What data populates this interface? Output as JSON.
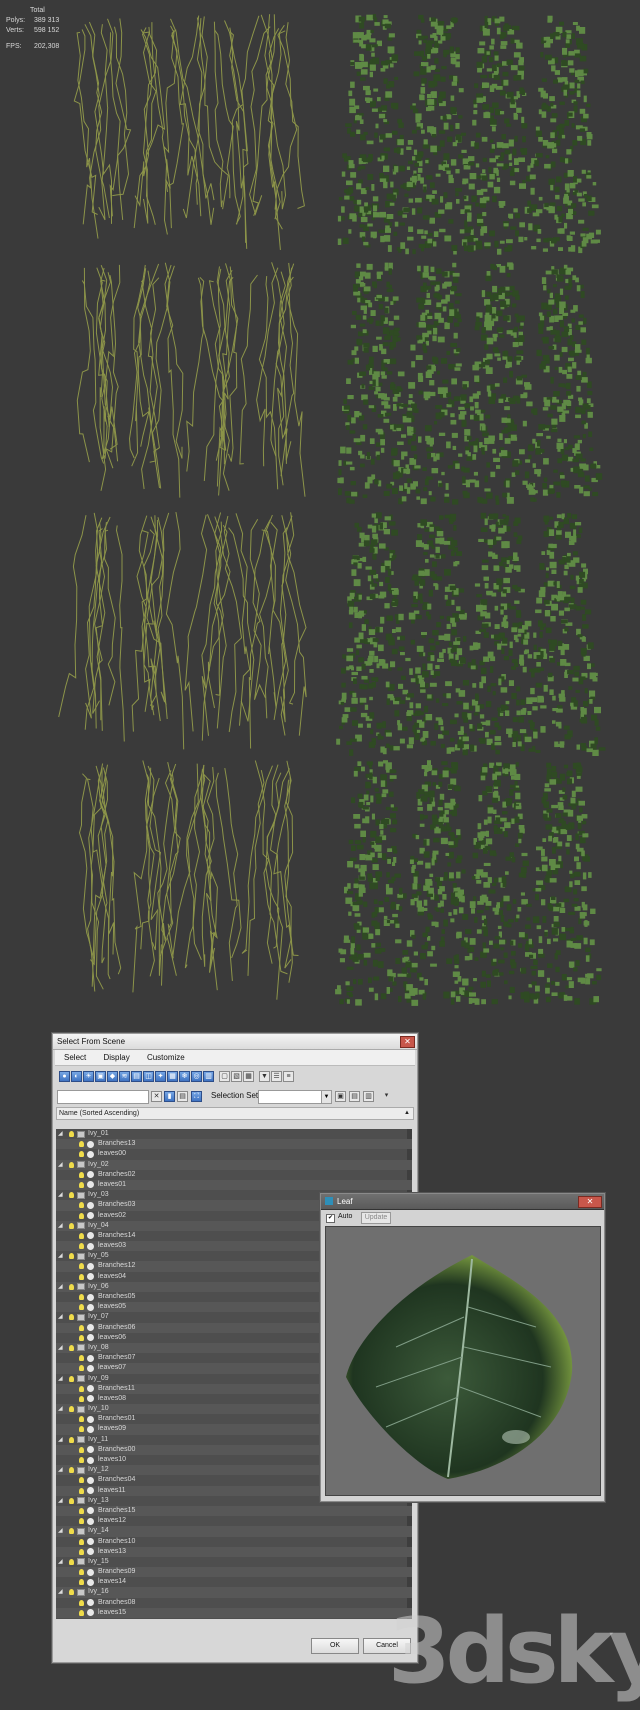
{
  "viewport_stats": {
    "title": "Total",
    "polys_label": "Polys:",
    "polys_value": "389 313",
    "verts_label": "Verts:",
    "verts_value": "598 152",
    "fps_label": "FPS:",
    "fps_value": "202,308"
  },
  "colors": {
    "viewport_bg": "#3a3a3a",
    "branch": "#8c9449",
    "foliage_dark": "#2f4a23",
    "foliage_light": "#5f8a45",
    "stats_text": "#e6c200"
  },
  "select_dialog": {
    "title": "Select From Scene",
    "close_icon": "✕",
    "menu": [
      "Select",
      "Display",
      "Customize"
    ],
    "selection_set_label": "Selection Set:",
    "selection_set_value": "",
    "column_header": "Name (Sorted Ascending)",
    "items": [
      {
        "name": "Ivy_01",
        "children": [
          "Branches13",
          "leaves00"
        ]
      },
      {
        "name": "Ivy_02",
        "children": [
          "Branches02",
          "leaves01"
        ]
      },
      {
        "name": "Ivy_03",
        "children": [
          "Branches03",
          "leaves02"
        ]
      },
      {
        "name": "Ivy_04",
        "children": [
          "Branches14",
          "leaves03"
        ]
      },
      {
        "name": "Ivy_05",
        "children": [
          "Branches12",
          "leaves04"
        ]
      },
      {
        "name": "Ivy_06",
        "children": [
          "Branches05",
          "leaves05"
        ]
      },
      {
        "name": "Ivy_07",
        "children": [
          "Branches06",
          "leaves06"
        ]
      },
      {
        "name": "Ivy_08",
        "children": [
          "Branches07",
          "leaves07"
        ]
      },
      {
        "name": "Ivy_09",
        "children": [
          "Branches11",
          "leaves08"
        ]
      },
      {
        "name": "Ivy_10",
        "children": [
          "Branches01",
          "leaves09"
        ]
      },
      {
        "name": "Ivy_11",
        "children": [
          "Branches00",
          "leaves10"
        ]
      },
      {
        "name": "Ivy_12",
        "children": [
          "Branches04",
          "leaves11"
        ]
      },
      {
        "name": "Ivy_13",
        "children": [
          "Branches15",
          "leaves12"
        ]
      },
      {
        "name": "Ivy_14",
        "children": [
          "Branches10",
          "leaves13"
        ]
      },
      {
        "name": "Ivy_15",
        "children": [
          "Branches09",
          "leaves14"
        ]
      },
      {
        "name": "Ivy_16",
        "children": [
          "Branches08",
          "leaves15"
        ]
      }
    ],
    "ok_label": "OK",
    "cancel_label": "Cancel"
  },
  "leaf_window": {
    "title": "Leaf",
    "close_icon": "✕",
    "auto_label": "Auto",
    "auto_checked": true,
    "update_label": "Update"
  },
  "watermark": "3dsky"
}
